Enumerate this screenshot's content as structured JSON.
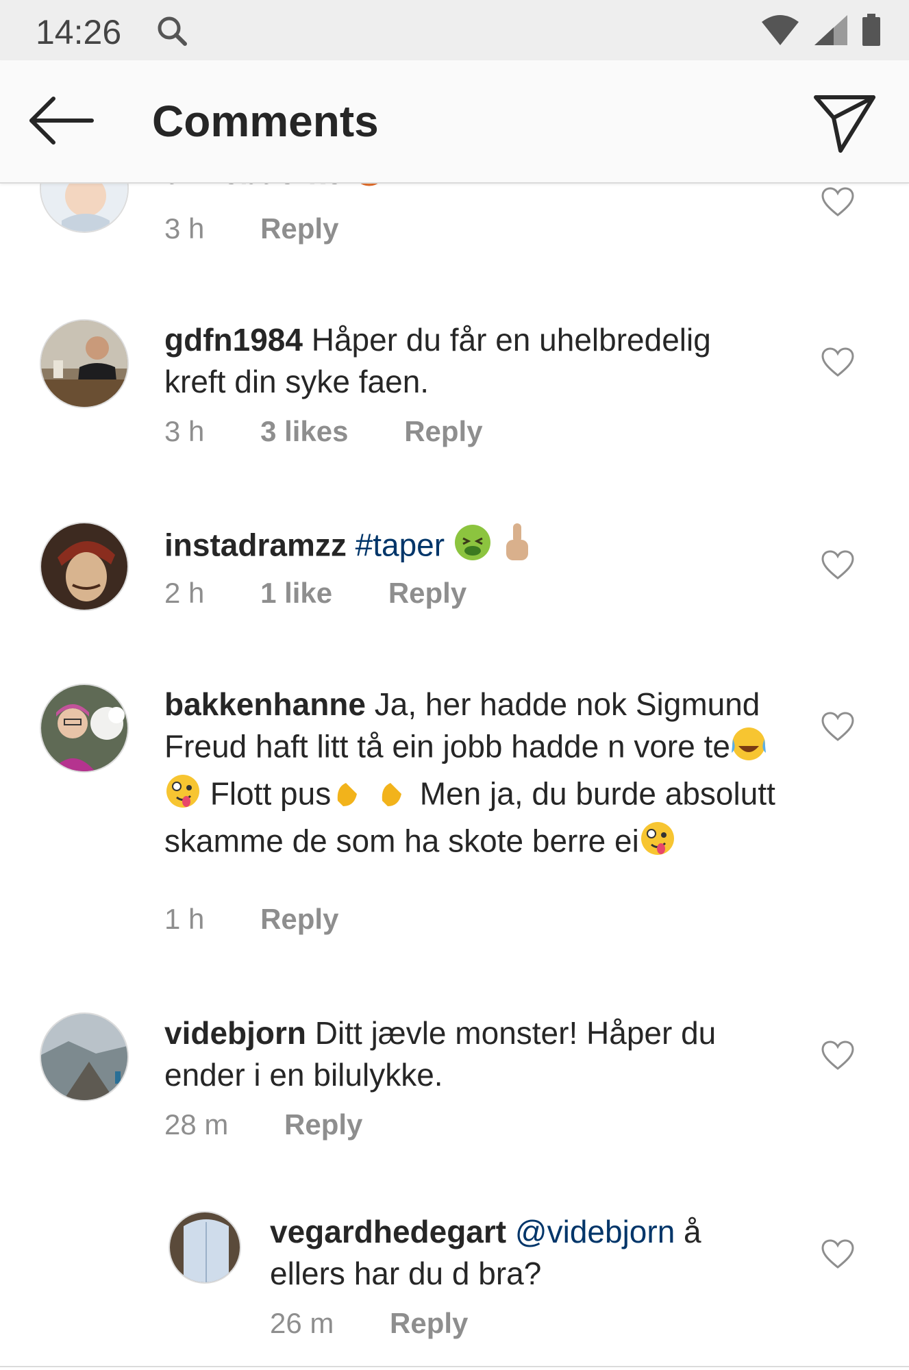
{
  "status": {
    "time": "14:26"
  },
  "header": {
    "title": "Comments"
  },
  "comments": [
    {
      "username": "unnebuerke",
      "text": "",
      "time": "3 h",
      "likes": "",
      "reply": "Reply"
    },
    {
      "username": "gdfn1984",
      "text": " Håper du får en uhelbredelig kreft din syke faen.",
      "time": "3 h",
      "likes": "3 likes",
      "reply": "Reply"
    },
    {
      "username": "instadramzz",
      "hashtag": "#taper",
      "time": "2 h",
      "likes": "1 like",
      "reply": "Reply"
    },
    {
      "username": "bakkenhanne",
      "line1": " Ja, her hadde nok Sigmund Freud haft litt tå ein jobb hadde n vore te",
      "line2": " Flott pus",
      "line3": " Men ja, du burde absolutt skamme de som ha skote berre ei",
      "time": "1 h",
      "likes": "",
      "reply": "Reply"
    },
    {
      "username": "videbjorn",
      "text": " Ditt jævle monster! Håper du ender i en bilulykke.",
      "time": "28 m",
      "likes": "",
      "reply": "Reply"
    },
    {
      "username": "vegardhedegart",
      "mention": "@videbjorn",
      "text": " å ellers har du d bra?",
      "time": "26 m",
      "likes": "",
      "reply": "Reply"
    }
  ],
  "icons": {
    "back": "arrow-left-icon",
    "share": "send-icon",
    "like": "heart-outline-icon",
    "search": "search-icon",
    "wifi": "wifi-icon",
    "signal": "signal-icon",
    "battery": "battery-icon"
  },
  "colors": {
    "text": "#262626",
    "meta": "#8e8e8e",
    "link": "#003569"
  }
}
